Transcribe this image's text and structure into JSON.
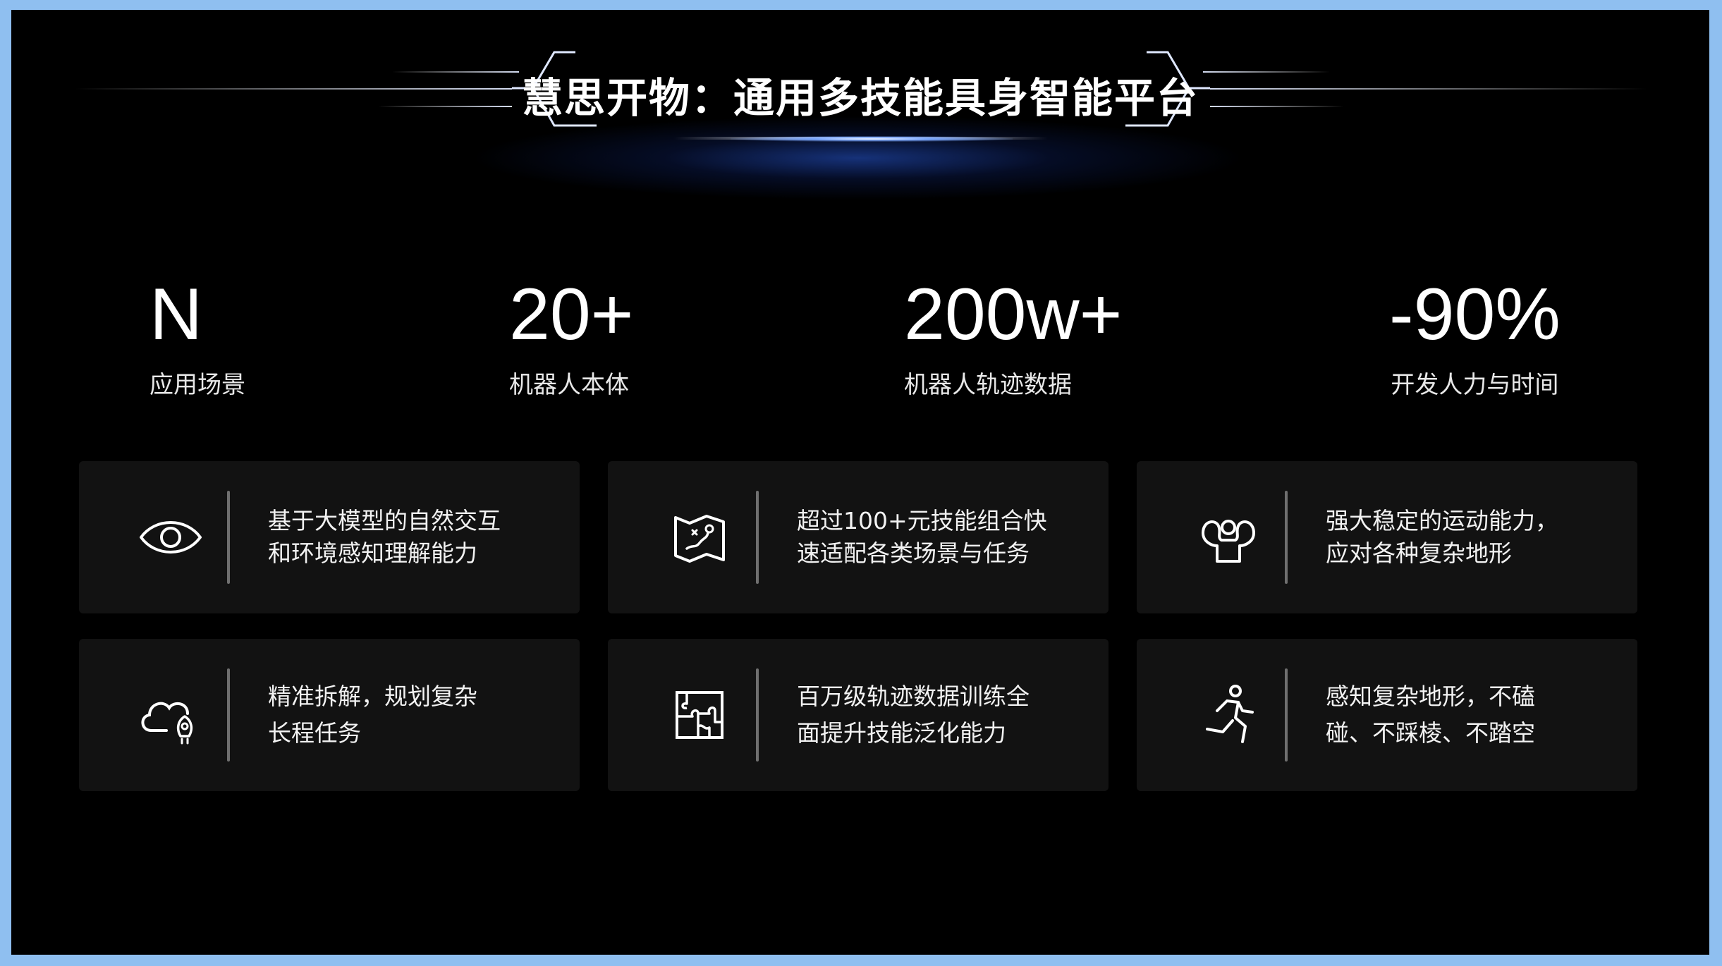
{
  "title": "慧思开物：通用多技能具身智能平台",
  "stats": [
    {
      "value": "N",
      "label": "应用场景"
    },
    {
      "value": "20+",
      "label": "机器人本体"
    },
    {
      "value": "200w+",
      "label": "机器人轨迹数据"
    },
    {
      "value": "-90%",
      "label": "开发人力与时间"
    }
  ],
  "cards": [
    {
      "icon": "eye-icon",
      "line1": "基于大模型的自然交互",
      "line2": "和环境感知理解能力"
    },
    {
      "icon": "map-icon",
      "line1": "超过100+元技能组合快",
      "line2": "速适配各类场景与任务"
    },
    {
      "icon": "strong-arm-icon",
      "line1": "强大稳定的运动能力，",
      "line2": "应对各种复杂地形"
    },
    {
      "icon": "cloud-rocket-icon",
      "line1": "精准拆解，规划复杂",
      "line2": "长程任务"
    },
    {
      "icon": "puzzle-icon",
      "line1": "百万级轨迹数据训练全",
      "line2": "面提升技能泛化能力"
    },
    {
      "icon": "running-person-icon",
      "line1": "感知复杂地形，不磕",
      "line2": "碰、不踩棱、不踏空"
    }
  ],
  "colors": {
    "background": "#000000",
    "card": "#121212",
    "frame": "#8fbff0",
    "glow": "#2f5fe0"
  }
}
